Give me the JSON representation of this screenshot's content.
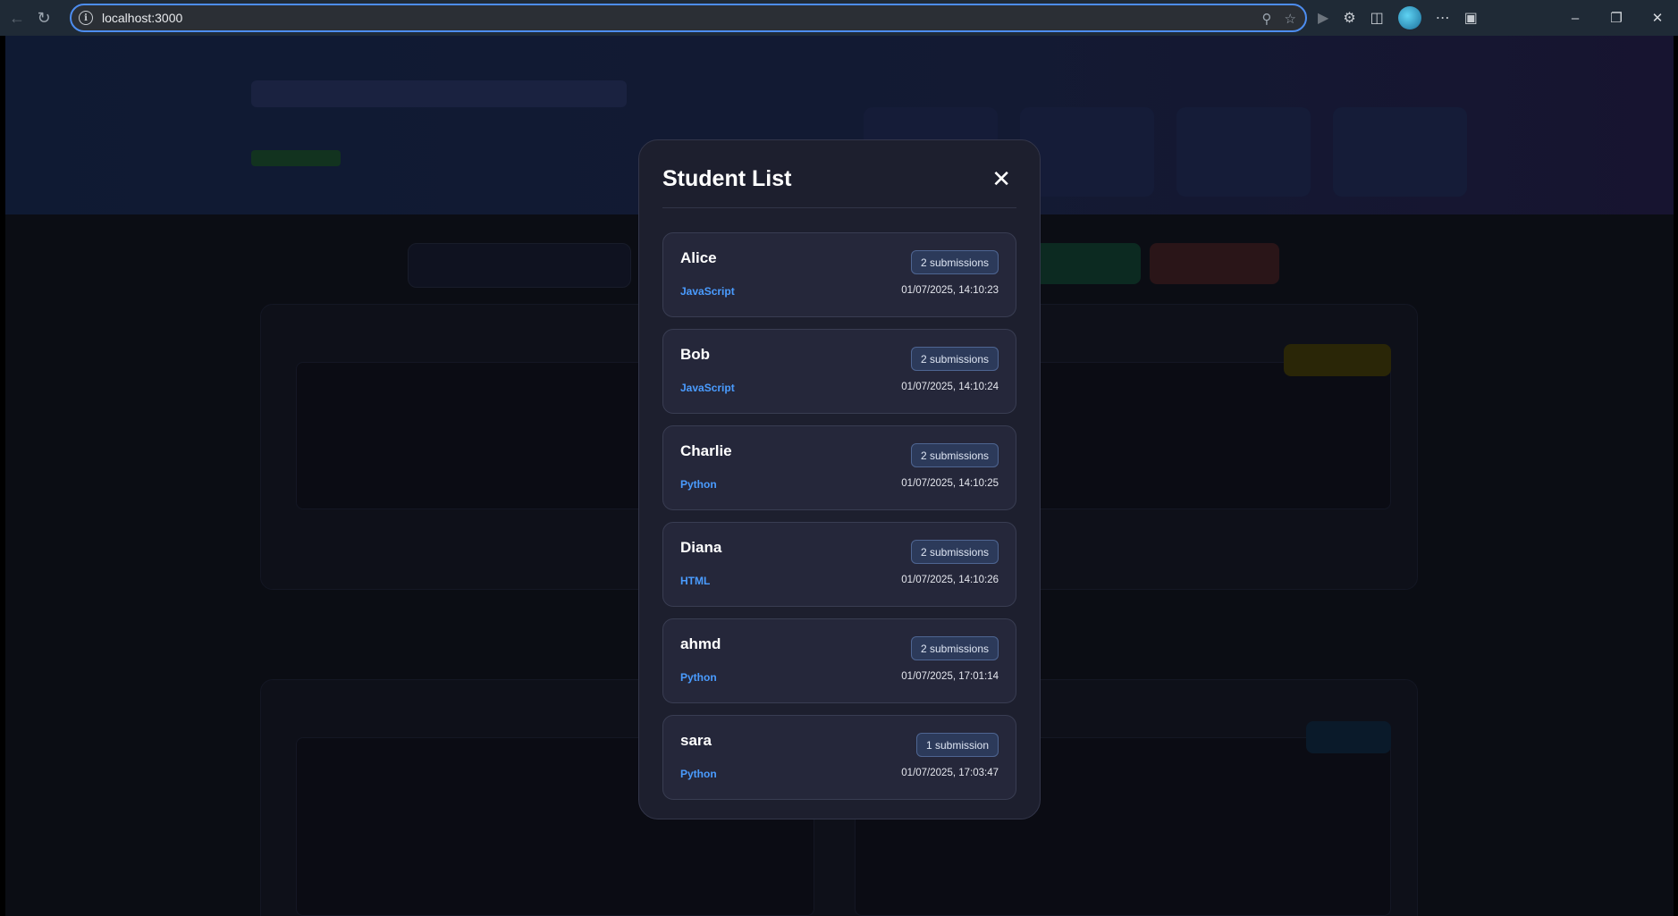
{
  "browser": {
    "url": "localhost:3000"
  },
  "modal": {
    "title": "Student List",
    "close_icon": "close-icon",
    "students": [
      {
        "name": "Alice",
        "submissions": "2 submissions",
        "language": "JavaScript",
        "timestamp": "01/07/2025, 14:10:23"
      },
      {
        "name": "Bob",
        "submissions": "2 submissions",
        "language": "JavaScript",
        "timestamp": "01/07/2025, 14:10:24"
      },
      {
        "name": "Charlie",
        "submissions": "2 submissions",
        "language": "Python",
        "timestamp": "01/07/2025, 14:10:25"
      },
      {
        "name": "Diana",
        "submissions": "2 submissions",
        "language": "HTML",
        "timestamp": "01/07/2025, 14:10:26"
      },
      {
        "name": "ahmd",
        "submissions": "2 submissions",
        "language": "Python",
        "timestamp": "01/07/2025, 17:01:14"
      },
      {
        "name": "sara",
        "submissions": "1 submission",
        "language": "Python",
        "timestamp": "01/07/2025, 17:03:47"
      }
    ]
  },
  "colors": {
    "modal_bg": "#1d1f2e",
    "card_bg": "#25273a",
    "language_accent": "#4a9cff",
    "badge_bg": "#2c3a5a"
  }
}
